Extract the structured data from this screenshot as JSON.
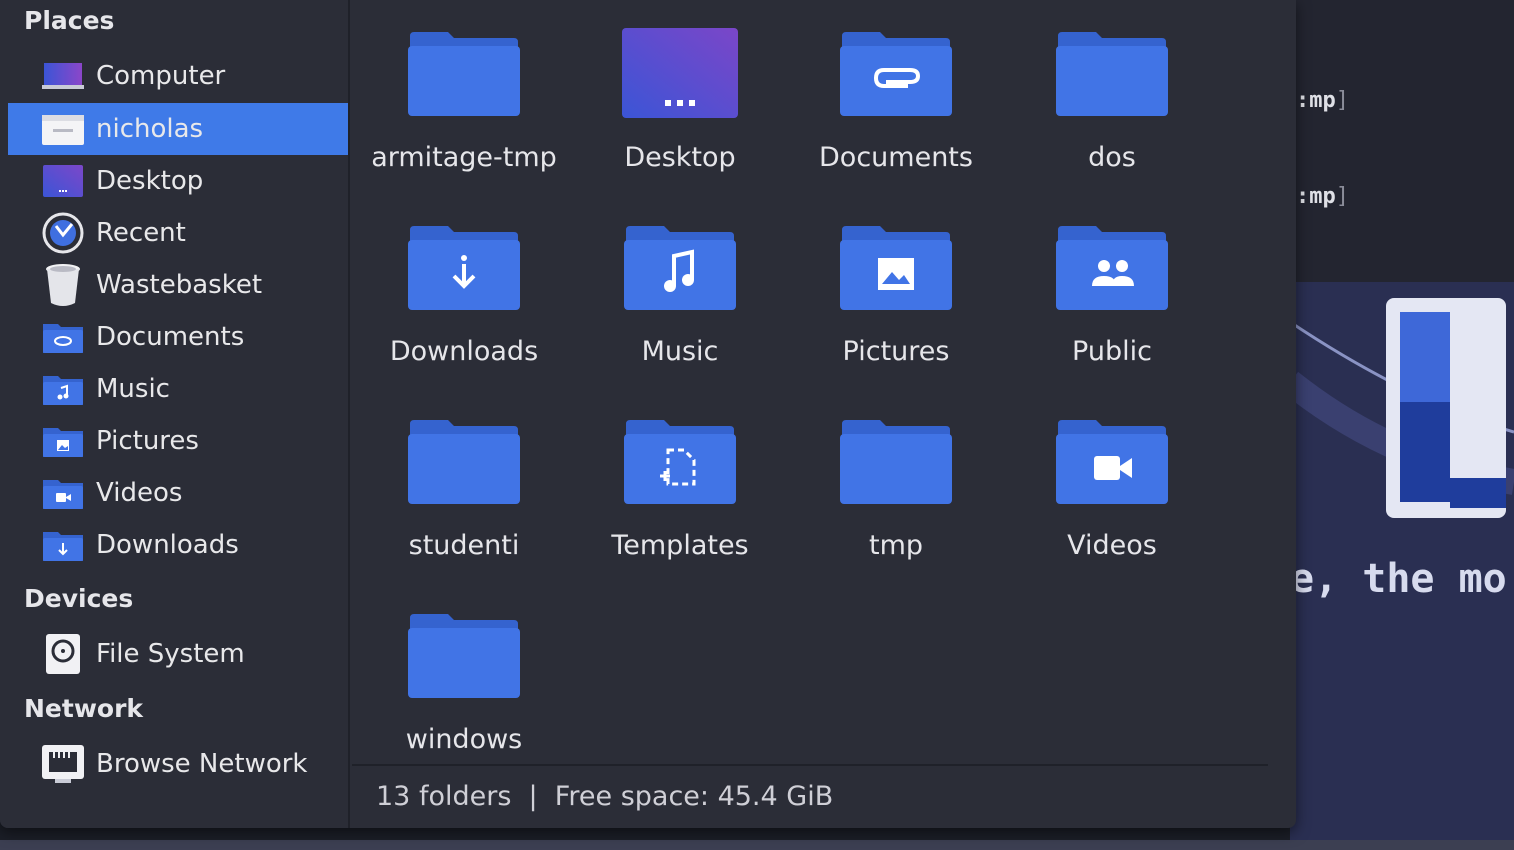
{
  "terminal": {
    "line1": ":mp",
    "line2": ":mp",
    "bracket": "]"
  },
  "wallpaper": {
    "text": "e, the mo"
  },
  "sidebar": {
    "places_title": "Places",
    "places": [
      {
        "label": "Computer",
        "icon": "computer-icon"
      },
      {
        "label": "nicholas",
        "icon": "home-folder-icon",
        "selected": true
      },
      {
        "label": "Desktop",
        "icon": "desktop-icon"
      },
      {
        "label": "Recent",
        "icon": "clock-icon"
      },
      {
        "label": "Wastebasket",
        "icon": "trash-icon"
      },
      {
        "label": "Documents",
        "icon": "documents-folder-icon"
      },
      {
        "label": "Music",
        "icon": "music-folder-icon"
      },
      {
        "label": "Pictures",
        "icon": "pictures-folder-icon"
      },
      {
        "label": "Videos",
        "icon": "videos-folder-icon"
      },
      {
        "label": "Downloads",
        "icon": "downloads-folder-icon"
      }
    ],
    "devices_title": "Devices",
    "devices": [
      {
        "label": "File System",
        "icon": "drive-icon"
      }
    ],
    "network_title": "Network",
    "network": [
      {
        "label": "Browse Network",
        "icon": "network-icon"
      }
    ]
  },
  "folders": [
    {
      "label": "armitage-tmp",
      "icon": "folder-icon"
    },
    {
      "label": "Desktop",
      "icon": "desktop-folder-icon"
    },
    {
      "label": "Documents",
      "icon": "documents-folder-icon"
    },
    {
      "label": "dos",
      "icon": "folder-icon"
    },
    {
      "label": "Downloads",
      "icon": "downloads-folder-icon"
    },
    {
      "label": "Music",
      "icon": "music-folder-icon"
    },
    {
      "label": "Pictures",
      "icon": "pictures-folder-icon"
    },
    {
      "label": "Public",
      "icon": "public-folder-icon"
    },
    {
      "label": "studenti",
      "icon": "folder-icon"
    },
    {
      "label": "Templates",
      "icon": "templates-folder-icon"
    },
    {
      "label": "tmp",
      "icon": "folder-icon"
    },
    {
      "label": "Videos",
      "icon": "videos-folder-icon"
    },
    {
      "label": "windows",
      "icon": "folder-icon"
    }
  ],
  "status": {
    "text": "13 folders  |  Free space: 45.4 GiB"
  },
  "colors": {
    "accent": "#3f7ae8",
    "folder": "#3f6fe0",
    "folder_tab": "#3563cf",
    "window_bg": "#2b2d37"
  }
}
